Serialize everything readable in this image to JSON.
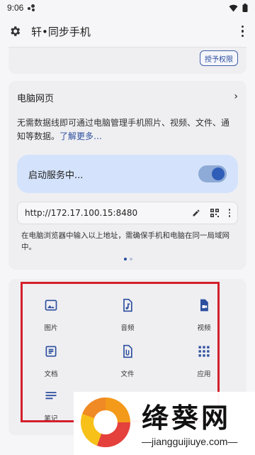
{
  "status": {
    "time": "9:06"
  },
  "appbar": {
    "title": "轩•同步手机"
  },
  "top_card": {
    "permission_button": "授予权限"
  },
  "pc_card": {
    "heading": "电脑网页",
    "description": "无需数据线即可通过电脑管理手机照片、视频、文件、通知等数据。",
    "learn_more": "了解更多…",
    "service_label": "启动服务中...",
    "service_on": true,
    "url": "http://172.17.100.15:8480",
    "hint": "在电脑浏览器中输入以上地址，需确保手机和电脑在同一局域网中。",
    "page_count": 2,
    "current_page": 1
  },
  "grid": {
    "items": [
      {
        "label": "图片",
        "icon": "image-icon"
      },
      {
        "label": "音频",
        "icon": "audio-file-icon"
      },
      {
        "label": "视频",
        "icon": "video-file-icon"
      },
      {
        "label": "文档",
        "icon": "document-icon"
      },
      {
        "label": "文件",
        "icon": "attachment-file-icon"
      },
      {
        "label": "应用",
        "icon": "apps-grid-icon"
      },
      {
        "label": "笔记",
        "icon": "notes-icon"
      }
    ]
  },
  "watermark": {
    "title": "绛葵网",
    "url": "—jiangguijiuye.com—"
  },
  "colors": {
    "accent": "#2d4f9e",
    "highlight": "#d4202a",
    "service_bg": "#d4e3fb"
  }
}
